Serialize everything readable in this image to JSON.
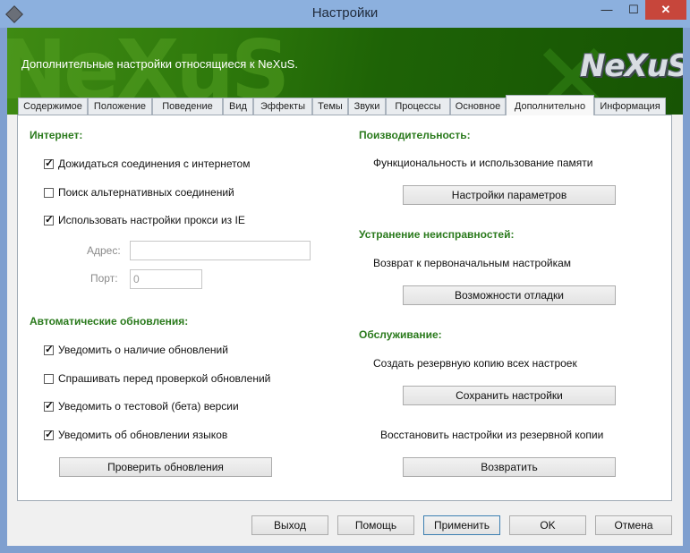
{
  "window": {
    "title": "Настройки",
    "minimize": "—",
    "maximize": "☐",
    "close": "✕"
  },
  "banner": {
    "text": "Дополнительные настройки относящиеся к NeXuS.",
    "watermark": "NeXuS",
    "logo": "NeXuS",
    "xmark": "✕"
  },
  "tabs": [
    "Содержимое",
    "Положение",
    "Поведение",
    "Вид",
    "Эффекты",
    "Темы",
    "Звуки",
    "Процессы",
    "Основное",
    "Дополнительно",
    "Информация"
  ],
  "active_tab": "Дополнительно",
  "internet": {
    "title": "Интернет:",
    "wait_connection": {
      "label": "Дожидаться соединения с интернетом",
      "checked": true
    },
    "alt_connections": {
      "label": "Поиск альтернативных соединений",
      "checked": false
    },
    "use_proxy": {
      "label": "Использовать настройки прокси из IE",
      "checked": true
    },
    "address_label": "Адрес:",
    "address_value": "",
    "port_label": "Порт:",
    "port_value": "0"
  },
  "updates": {
    "title": "Автоматические обновления:",
    "notify_updates": {
      "label": "Уведомить о наличие обновлений",
      "checked": true
    },
    "ask_before_check": {
      "label": "Спрашивать перед проверкой обновлений",
      "checked": false
    },
    "notify_beta": {
      "label": "Уведомить о тестовой (бета) версии",
      "checked": true
    },
    "notify_languages": {
      "label": "Уведомить об обновлении языков",
      "checked": true
    },
    "check_button": "Проверить обновления"
  },
  "performance": {
    "title": "Поизводительность:",
    "desc": "Функциональность и использование памяти",
    "button": "Настройки параметров"
  },
  "troubleshooting": {
    "title": "Устранение неисправностей:",
    "desc": "Возврат к первоначальным настройкам",
    "button": "Возможности отладки"
  },
  "maintenance": {
    "title": "Обслуживание:",
    "backup_desc": "Создать резервную копию всех настроек",
    "backup_button": "Сохранить настройки",
    "restore_desc": "Восстановить настройки из резервной копии",
    "restore_button": "Возвратить"
  },
  "footer": {
    "exit": "Выход",
    "help": "Помощь",
    "apply": "Применить",
    "ok": "OK",
    "cancel": "Отмена"
  }
}
